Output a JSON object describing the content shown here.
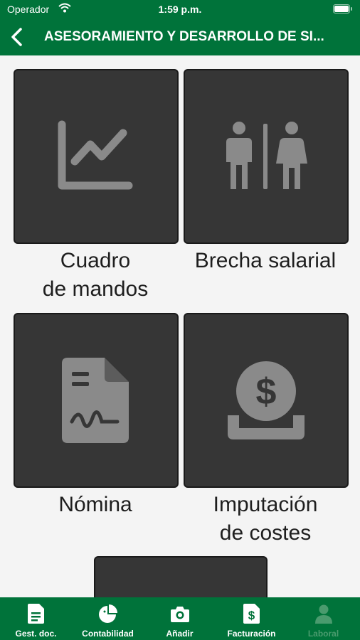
{
  "status_bar": {
    "carrier": "Operador",
    "time": "1:59 p.m."
  },
  "nav": {
    "title": "ASESORAMIENTO Y DESARROLLO DE SI..."
  },
  "tiles": [
    {
      "label_line1": "Cuadro",
      "label_line2": "de mandos",
      "icon": "line-chart-icon"
    },
    {
      "label_line1": "Brecha salarial",
      "label_line2": "",
      "icon": "restroom-icon"
    },
    {
      "label_line1": "Nómina",
      "label_line2": "",
      "icon": "payroll-document-icon"
    },
    {
      "label_line1": "Imputación",
      "label_line2": "de costes",
      "icon": "coin-deposit-icon"
    }
  ],
  "tab_bar": {
    "items": [
      {
        "label": "Gest. doc.",
        "icon": "document-icon",
        "active": true
      },
      {
        "label": "Contabilidad",
        "icon": "pie-chart-icon",
        "active": true
      },
      {
        "label": "Añadir",
        "icon": "camera-icon",
        "active": true
      },
      {
        "label": "Facturación",
        "icon": "invoice-icon",
        "active": true
      },
      {
        "label": "Laboral",
        "icon": "person-icon",
        "active": false
      }
    ]
  },
  "colors": {
    "brand_green": "#00733a",
    "tile_bg": "#363636",
    "icon_gray": "#8a8a8a",
    "inactive_tab": "#4a9b6e"
  }
}
